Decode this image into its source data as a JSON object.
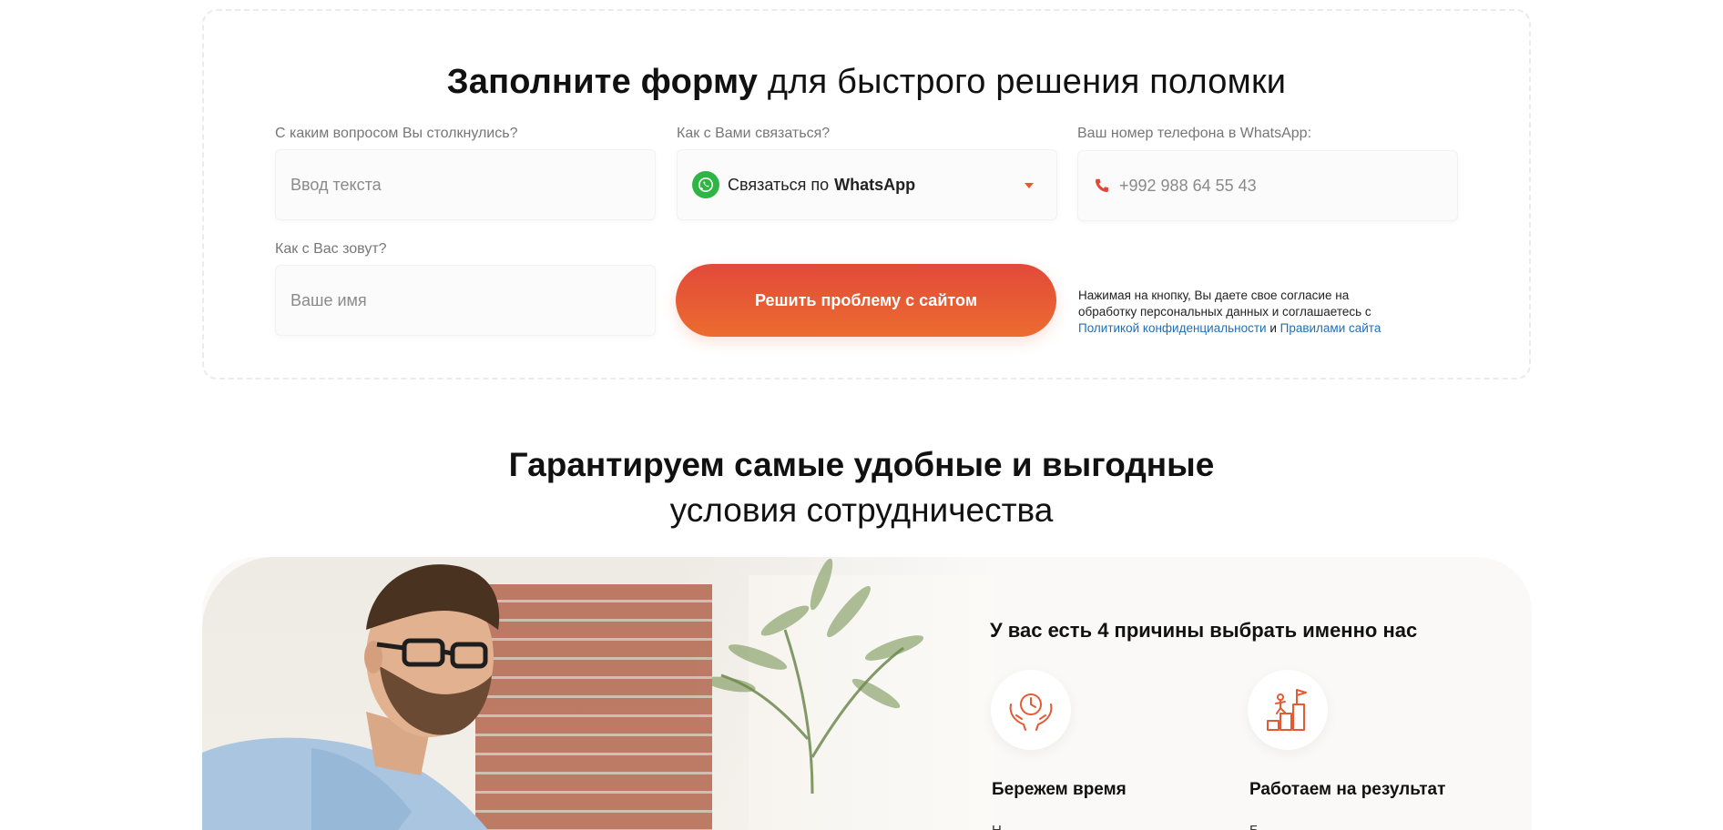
{
  "form": {
    "title_bold": "Заполните форму",
    "title_regular": " для быстрого решения поломки",
    "question": {
      "label": "С каким вопросом Вы столкнулись?",
      "placeholder": "Ввод текста"
    },
    "contact": {
      "label": "Как с Вами связаться?",
      "value_prefix": "Связаться по",
      "value_strong": "WhatsApp",
      "icon": "whatsapp-icon"
    },
    "phone": {
      "label": "Ваш номер телефона в WhatsApp:",
      "placeholder": "+992 988 64 55 43",
      "icon": "phone-icon"
    },
    "name": {
      "label": "Как с Вас зовут?",
      "placeholder": "Ваше имя"
    },
    "submit_label": "Решить проблему с сайтом",
    "consent": {
      "text": "Нажимая на кнопку, Вы даете свое согласие на обработку персональных данных и соглашаетесь с",
      "privacy_link": "Политикой конфиденциальности",
      "and": " и ",
      "rules_link": "Правилами сайта"
    }
  },
  "guarantee": {
    "line1": "Гарантируем самые удобные и выгодные",
    "line2": "условия сотрудничества"
  },
  "reasons": {
    "title": "У вас есть 4 причины выбрать именно нас",
    "items": [
      {
        "title": "Бережем время",
        "desc": "Н",
        "icon": "clock-in-hands-icon"
      },
      {
        "title": "Работаем на результат",
        "desc": "Б",
        "icon": "stairs-to-goal-icon"
      }
    ]
  },
  "colors": {
    "accent": "#ec5f32",
    "whatsapp": "#2fb543",
    "link": "#1f6fb7"
  }
}
